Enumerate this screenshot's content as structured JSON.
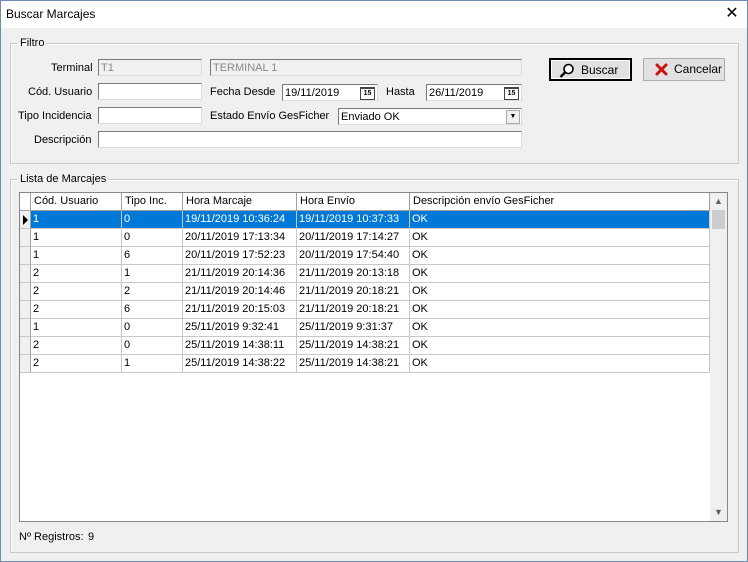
{
  "window": {
    "title": "Buscar Marcajes"
  },
  "filtro": {
    "legend": "Filtro",
    "terminal_label": "Terminal",
    "terminal_code": "T1",
    "terminal_name": "TERMINAL 1",
    "cod_usuario_label": "Cód. Usuario",
    "cod_usuario_value": "",
    "fecha_desde_label": "Fecha Desde",
    "fecha_desde_value": "19/11/2019",
    "hasta_label": "Hasta",
    "hasta_value": "26/11/2019",
    "tipo_incidencia_label": "Tipo Incidencia",
    "tipo_incidencia_value": "",
    "estado_label": "Estado Envío GesFicher",
    "estado_value": "Enviado OK",
    "descripcion_label": "Descripción",
    "descripcion_value": "",
    "calendar_icon_text": "15"
  },
  "buttons": {
    "buscar": "Buscar",
    "cancelar": "Cancelar"
  },
  "lista": {
    "legend": "Lista de Marcajes",
    "columns": [
      "Cód. Usuario",
      "Tipo Inc.",
      "Hora Marcaje",
      "Hora Envío",
      "Descripción envío GesFicher"
    ],
    "rows": [
      [
        "1",
        "0",
        "19/11/2019 10:36:24",
        "19/11/2019 10:37:33",
        "OK"
      ],
      [
        "1",
        "0",
        "20/11/2019 17:13:34",
        "20/11/2019 17:14:27",
        "OK"
      ],
      [
        "1",
        "6",
        "20/11/2019 17:52:23",
        "20/11/2019 17:54:40",
        "OK"
      ],
      [
        "2",
        "1",
        "21/11/2019 20:14:36",
        "21/11/2019 20:13:18",
        "OK"
      ],
      [
        "2",
        "2",
        "21/11/2019 20:14:46",
        "21/11/2019 20:18:21",
        "OK"
      ],
      [
        "2",
        "6",
        "21/11/2019 20:15:03",
        "21/11/2019 20:18:21",
        "OK"
      ],
      [
        "1",
        "0",
        "25/11/2019 9:32:41",
        "25/11/2019 9:31:37",
        "OK"
      ],
      [
        "2",
        "0",
        "25/11/2019 14:38:11",
        "25/11/2019 14:38:21",
        "OK"
      ],
      [
        "2",
        "1",
        "25/11/2019 14:38:22",
        "25/11/2019 14:38:21",
        "OK"
      ]
    ],
    "selected_row": 0
  },
  "footer": {
    "registros_label": "Nº Registros:",
    "registros_value": "9"
  },
  "colors": {
    "selection": "#0078d7",
    "cancel_icon": "#cc1111"
  }
}
